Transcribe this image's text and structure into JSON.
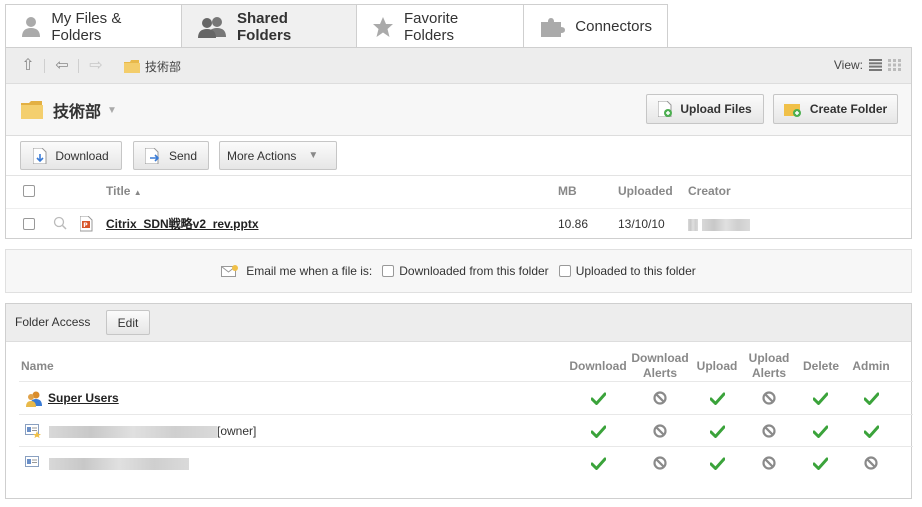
{
  "tabs": [
    {
      "label": "My Files & Folders",
      "icon": "user-icon",
      "active": false
    },
    {
      "label": "Shared Folders",
      "icon": "users-icon",
      "active": true
    },
    {
      "label": "Favorite Folders",
      "icon": "star-icon",
      "active": false
    },
    {
      "label": "Connectors",
      "icon": "puzzle-icon",
      "active": false
    }
  ],
  "navbar": {
    "breadcrumb": "技術部",
    "view_label": "View:"
  },
  "folder": {
    "title": "技術部",
    "upload_button": "Upload Files",
    "create_button": "Create Folder"
  },
  "actions": {
    "download": "Download",
    "send": "Send",
    "more": "More Actions"
  },
  "file_table": {
    "headers": {
      "title": "Title",
      "mb": "MB",
      "uploaded": "Uploaded",
      "creator": "Creator"
    },
    "rows": [
      {
        "title": "Citrix_SDN戦略v2_rev.pptx",
        "mb": "10.86",
        "uploaded": "13/10/10"
      }
    ]
  },
  "email": {
    "label": "Email me when a file is:",
    "option_downloaded": "Downloaded from this folder",
    "option_uploaded": "Uploaded to this folder"
  },
  "access": {
    "title": "Folder Access",
    "edit_button": "Edit",
    "headers": {
      "name": "Name",
      "download": "Download",
      "download_alerts_1": "Download",
      "download_alerts_2": "Alerts",
      "upload": "Upload",
      "upload_alerts_1": "Upload",
      "upload_alerts_2": "Alerts",
      "delete": "Delete",
      "admin": "Admin"
    },
    "rows": [
      {
        "name": "Super Users",
        "suffix": "",
        "perms": [
          "check",
          "no",
          "check",
          "no",
          "check",
          "check"
        ]
      },
      {
        "name": "",
        "suffix": "[owner]",
        "perms": [
          "check",
          "no",
          "check",
          "no",
          "check",
          "check"
        ]
      },
      {
        "name": "",
        "suffix": "",
        "perms": [
          "check",
          "no",
          "check",
          "no",
          "check",
          "no"
        ]
      }
    ]
  },
  "colors": {
    "check": "#3ba33b",
    "no": "#8a8a8a",
    "folder": "#f0c048"
  }
}
